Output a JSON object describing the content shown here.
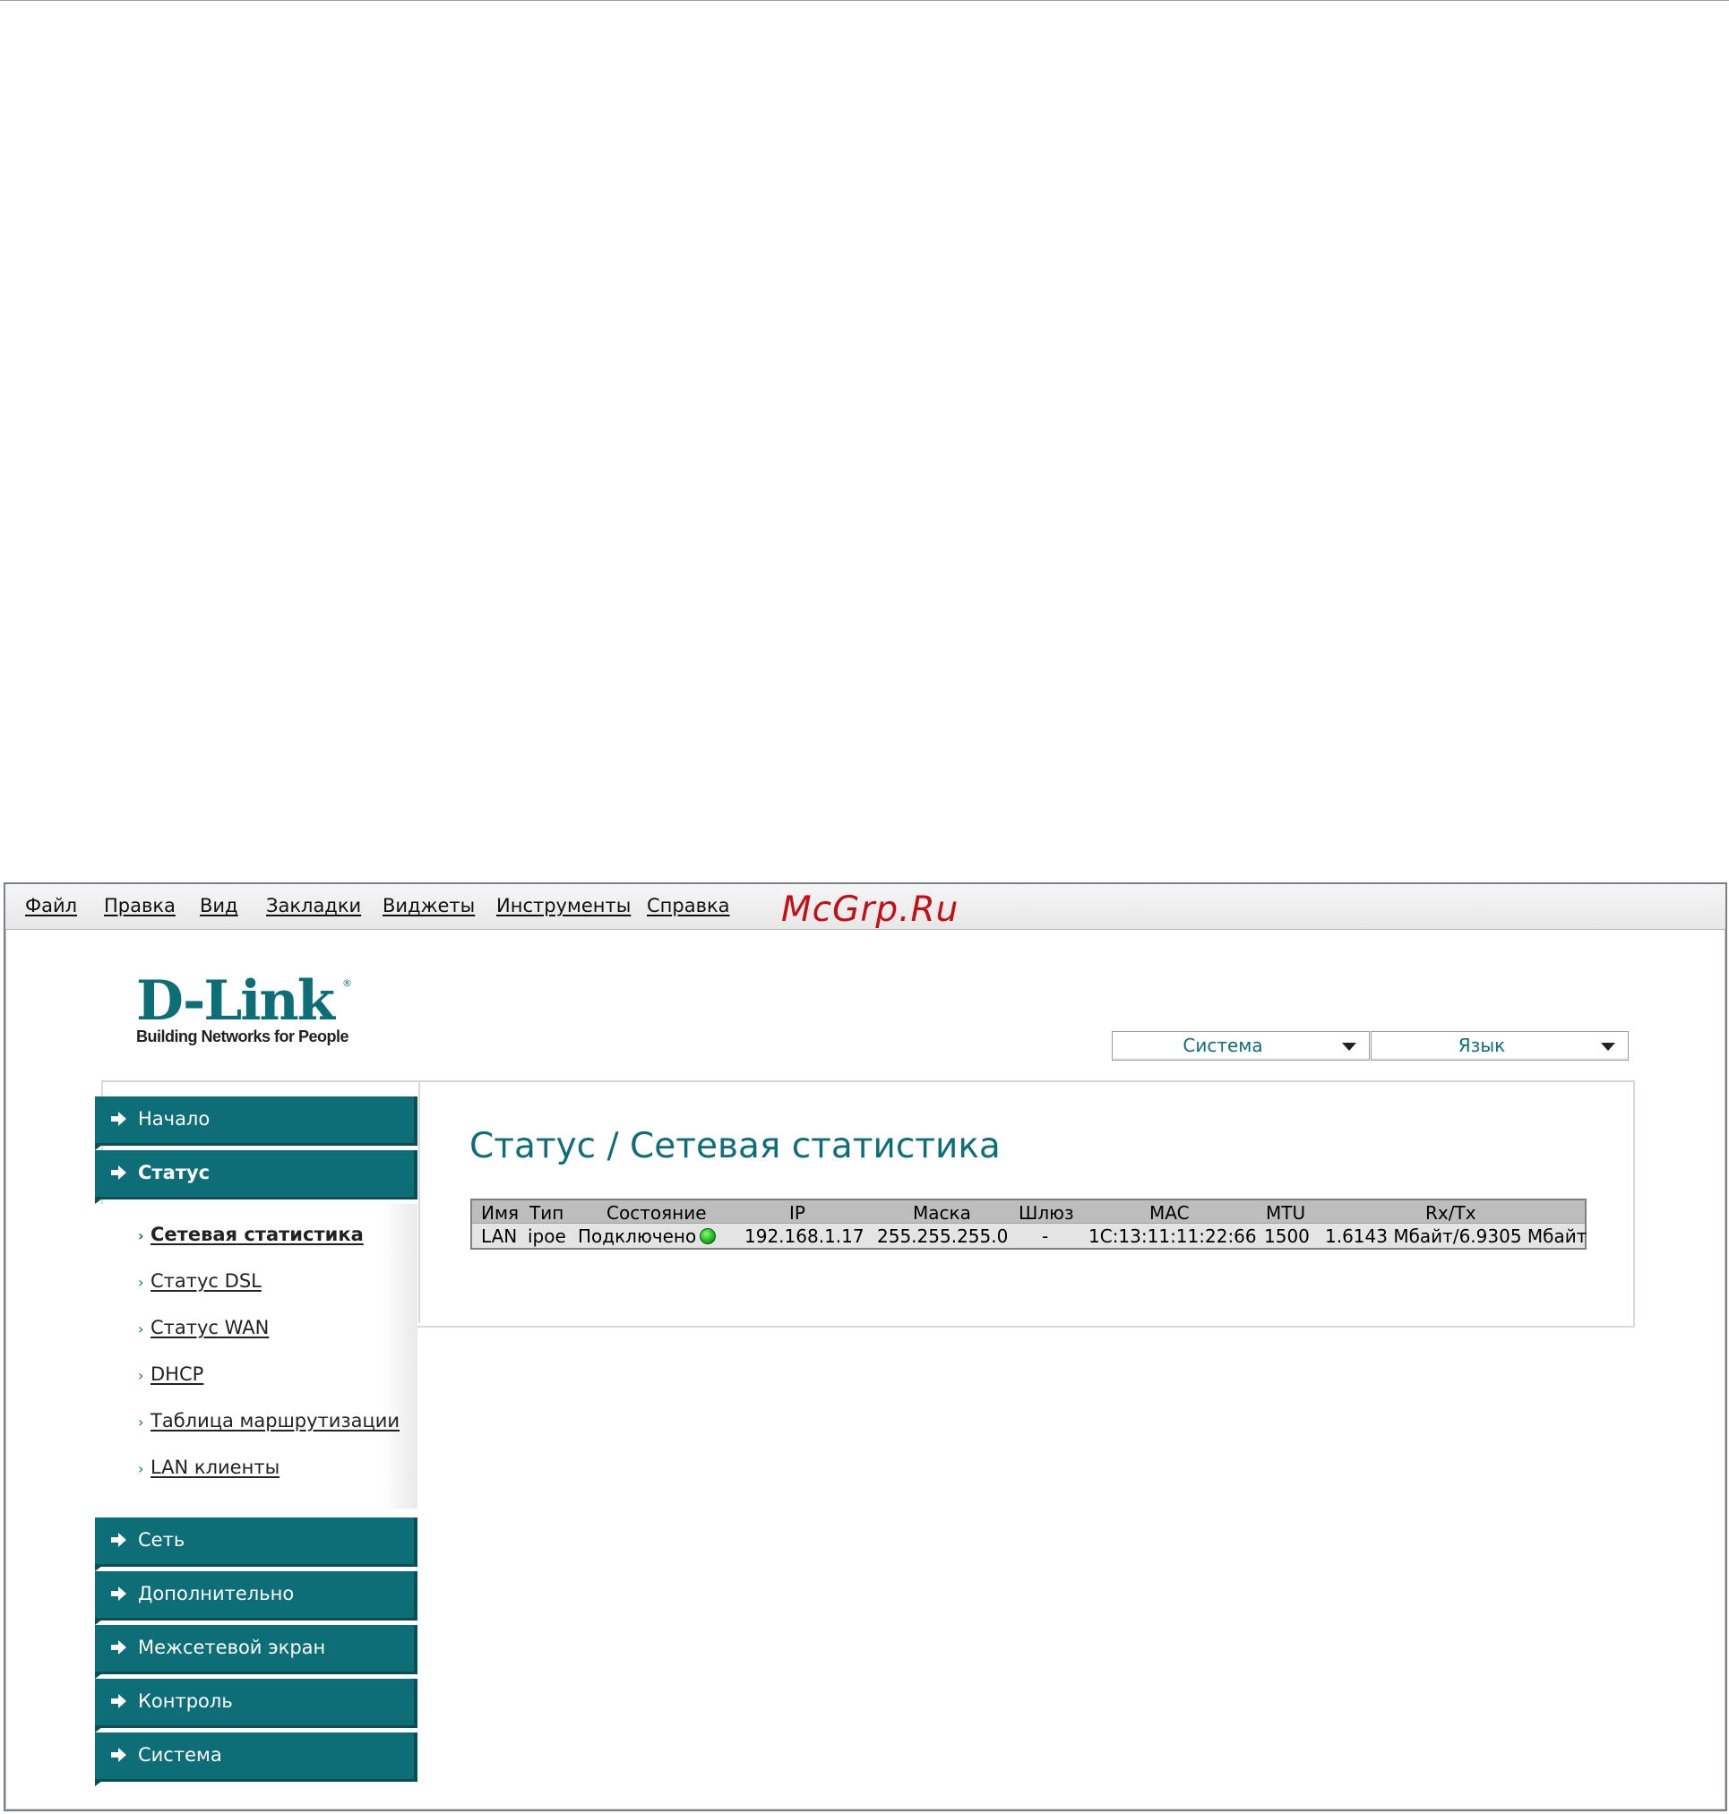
{
  "menu": {
    "items": [
      {
        "label": "Файл"
      },
      {
        "label": "Правка"
      },
      {
        "label": "Вид"
      },
      {
        "label": "Закладки"
      },
      {
        "label": "Виджеты"
      },
      {
        "label": "Инструменты"
      },
      {
        "label": "Справка"
      }
    ],
    "watermark": "McGrp.Ru"
  },
  "logo": {
    "main": "D-Link",
    "tagline": "Building Networks for People",
    "reg_mark": "®"
  },
  "header": {
    "system_dropdown": "Система",
    "language_dropdown": "Язык"
  },
  "nav": {
    "sections": [
      {
        "label": "Начало"
      },
      {
        "label": "Статус"
      },
      {
        "label": "Сеть"
      },
      {
        "label": "Дополнительно"
      },
      {
        "label": "Межсетевой экран"
      },
      {
        "label": "Контроль"
      },
      {
        "label": "Система"
      }
    ],
    "status_items": [
      {
        "label": "Сетевая статистика"
      },
      {
        "label": "Статус DSL"
      },
      {
        "label": "Статус WAN"
      },
      {
        "label": "DHCP"
      },
      {
        "label": "Таблица маршрутизации"
      },
      {
        "label": "LAN клиенты"
      }
    ]
  },
  "main": {
    "title": "Статус / Сетевая статистика",
    "table": {
      "headers": [
        "Имя",
        "Тип",
        "Состояние",
        "IP",
        "Маска",
        "Шлюз",
        "MAC",
        "MTU",
        "Rx/Tx"
      ],
      "rows": [
        {
          "name": "LAN",
          "type": "ipoe",
          "state": "Подключено",
          "ip": "192.168.1.17",
          "mask": "255.255.255.0",
          "gateway": "-",
          "mac": "1C:13:11:11:22:66",
          "mtu": "1500",
          "rxtx": "1.6143 Мбайт/6.9305 Мбайт"
        }
      ]
    }
  },
  "colors": {
    "brand_teal": "#0e6e78",
    "status_connected": "#15a015",
    "watermark_red": "#c40f16"
  }
}
